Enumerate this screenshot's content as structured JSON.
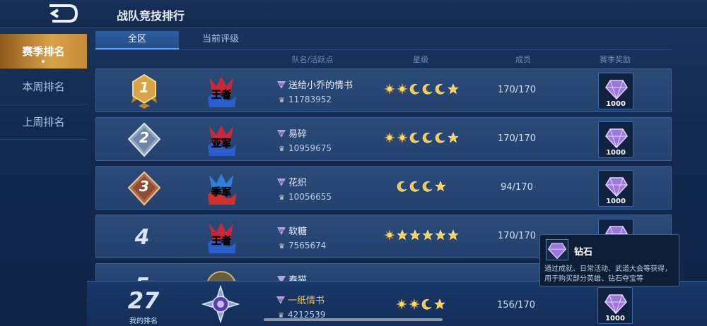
{
  "header": {
    "title": "战队竞技排行"
  },
  "sidebar": {
    "items": [
      {
        "label": "赛季排名"
      },
      {
        "label": "本周排名"
      },
      {
        "label": "上周排名"
      }
    ]
  },
  "tabs": [
    {
      "label": "全区"
    },
    {
      "label": "当前评级"
    }
  ],
  "columns": {
    "team": "队名/活跃点",
    "stars": "星级",
    "members": "成员",
    "reward": "赛季奖励"
  },
  "rows": [
    {
      "rank": "1",
      "name": "送给小乔的情书",
      "active": "11783952",
      "stars": [
        "sun",
        "sun",
        "moon",
        "moon",
        "moon",
        "star"
      ],
      "members": "170/170",
      "reward": "1000",
      "tier": "王者"
    },
    {
      "rank": "2",
      "name": "易碎",
      "active": "10959675",
      "stars": [
        "sun",
        "sun",
        "moon",
        "moon",
        "moon",
        "star"
      ],
      "members": "170/170",
      "reward": "1000",
      "tier": "亚军"
    },
    {
      "rank": "3",
      "name": "花织",
      "active": "10056655",
      "stars": [
        "moon",
        "moon",
        "moon",
        "star"
      ],
      "members": "94/170",
      "reward": "1000",
      "tier": "季军"
    },
    {
      "rank": "4",
      "name": "软糖",
      "active": "7565674",
      "stars": [
        "sun",
        "star",
        "star",
        "star",
        "star",
        "star"
      ],
      "members": "170/170",
      "reward": "",
      "tier": "王者"
    },
    {
      "rank": "5",
      "name": "春猫",
      "active": "",
      "stars": [],
      "members": "",
      "reward": "",
      "tier": ""
    }
  ],
  "my_rank": {
    "rank": "27",
    "label": "我的排名",
    "name": "一纸情书",
    "active": "4212539",
    "stars": [
      "sun",
      "sun",
      "moon",
      "star"
    ],
    "members": "156/170",
    "reward": "1000"
  },
  "tooltip": {
    "title": "钻石",
    "description": "通过成就、日常活动、武道大会等获得，用于购买部分英雄、钻石夺宝等"
  },
  "colors": {
    "gold": "#f1c24a",
    "accent_orange": "#d9a34a",
    "panel": "#24426e"
  }
}
